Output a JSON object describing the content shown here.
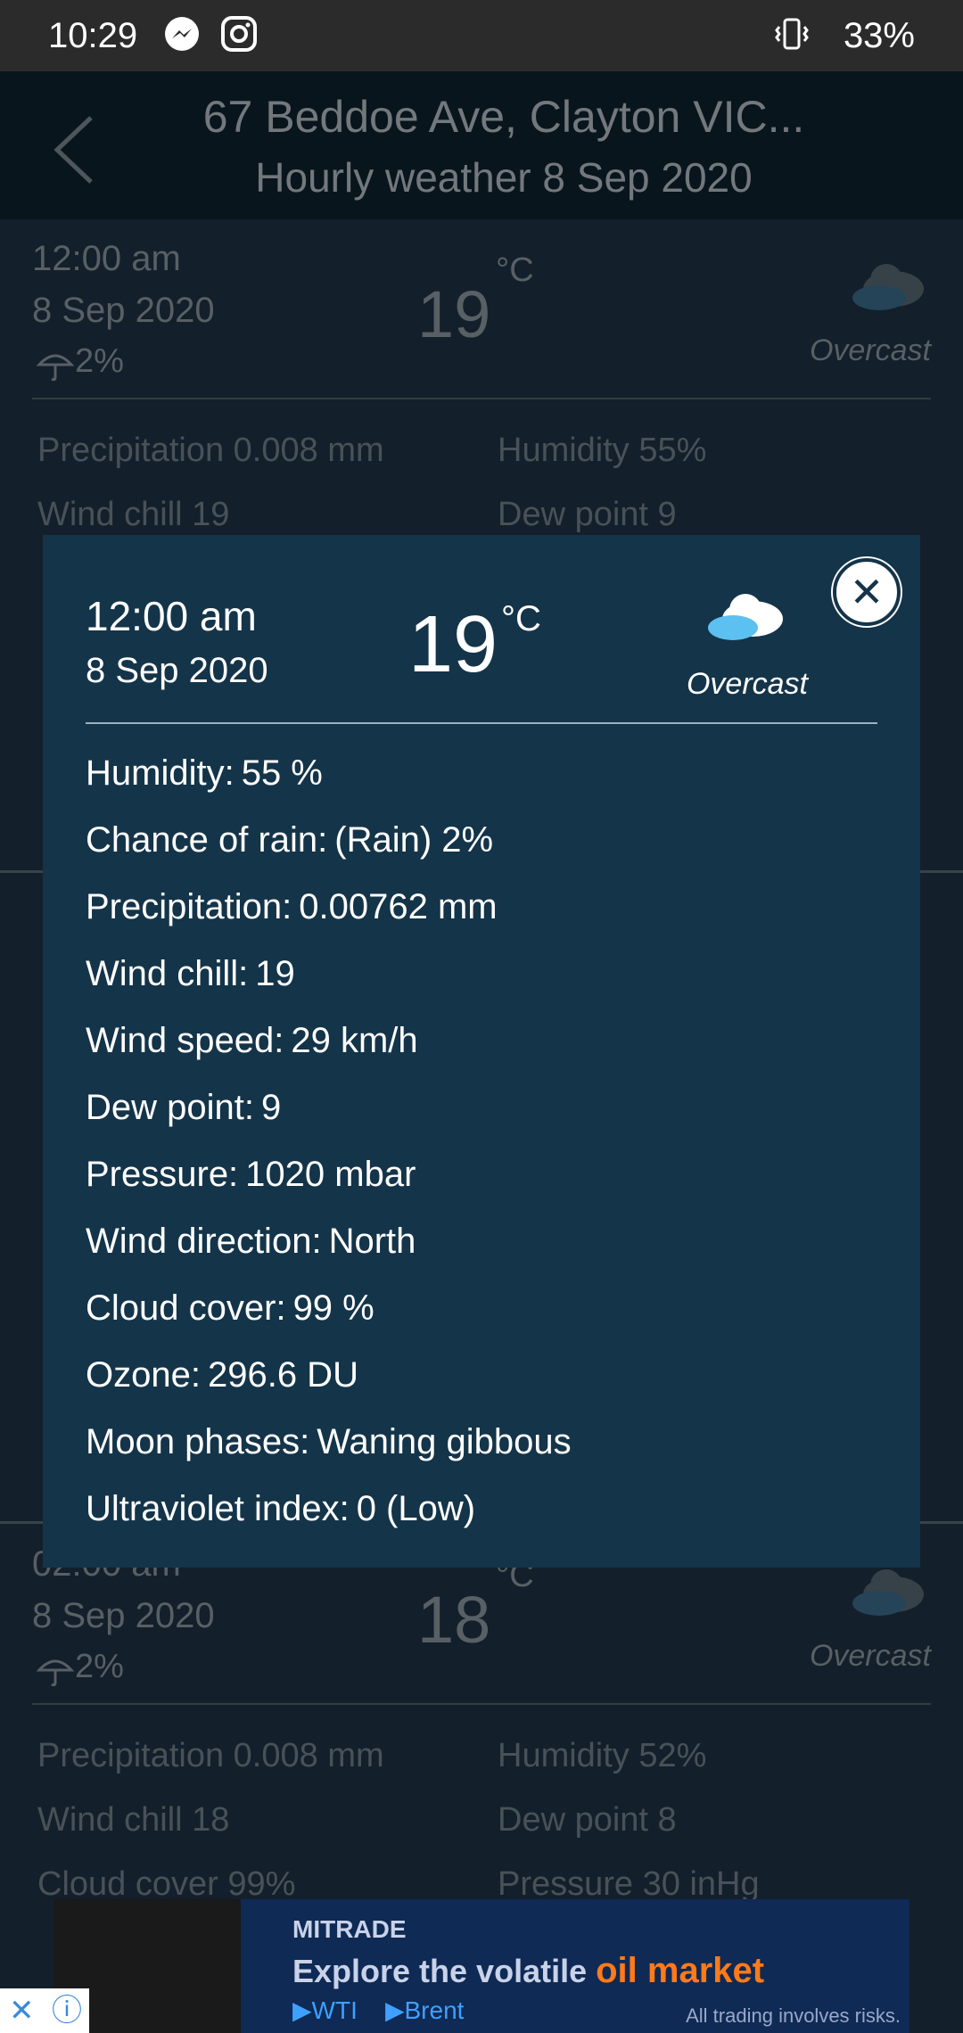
{
  "status_bar": {
    "time": "10:29",
    "battery": "33%"
  },
  "header": {
    "title": "67 Beddoe Ave, Clayton VIC...",
    "subtitle": "Hourly weather 8 Sep 2020"
  },
  "background_cards": [
    {
      "time": "12:00 am",
      "date": "8 Sep 2020",
      "rain": "2%",
      "temp": "19",
      "unit": "°C",
      "condition": "Overcast",
      "precipitation": "Precipitation 0.008 mm",
      "humidity": "Humidity 55%",
      "wind_chill": "Wind chill 19",
      "dew_point": "Dew point 9"
    },
    {
      "time": "02:00 am",
      "date": "8 Sep 2020",
      "rain": "2%",
      "temp": "18",
      "unit": "°C",
      "condition": "Overcast",
      "precipitation": "Precipitation 0.008 mm",
      "humidity": "Humidity 52%",
      "wind_chill": "Wind chill 18",
      "dew_point": "Dew point 8",
      "cloud_cover": "Cloud cover 99%",
      "pressure": "Pressure 30 inHg"
    }
  ],
  "modal": {
    "time": "12:00 am",
    "date": "8 Sep 2020",
    "temp": "19",
    "unit": "°C",
    "condition": "Overcast",
    "close_label": "✕",
    "rows": [
      {
        "label": "Humidity:",
        "value": "55 %"
      },
      {
        "label": "Chance of rain:",
        "value": "(Rain) 2%"
      },
      {
        "label": "Precipitation:",
        "value": "0.00762 mm"
      },
      {
        "label": "Wind chill:",
        "value": "19"
      },
      {
        "label": "Wind speed:",
        "value": "29 km/h"
      },
      {
        "label": "Dew point:",
        "value": "9"
      },
      {
        "label": "Pressure:",
        "value": "1020 mbar"
      },
      {
        "label": "Wind direction:",
        "value": "North"
      },
      {
        "label": "Cloud cover:",
        "value": "99 %"
      },
      {
        "label": "Ozone:",
        "value": "296.6 DU"
      },
      {
        "label": "Moon phases:",
        "value": "Waning gibbous"
      },
      {
        "label": "Ultraviolet index:",
        "value": "0 (Low)"
      }
    ]
  },
  "ad": {
    "brand": "MITRADE",
    "line_prefix": "Explore the volatile",
    "line_highlight": "oil market",
    "tag1": "▶WTI",
    "tag2": "▶Brent",
    "risk": "All trading involves risks."
  },
  "icons": {
    "cloud": "cloud-icon",
    "umbrella": "umbrella-icon",
    "back": "back-arrow-icon",
    "close": "close-icon"
  },
  "colors": {
    "background": "#1f3345",
    "header": "#102230",
    "modal": "#143449",
    "ad_highlight": "#ff7a1a"
  }
}
